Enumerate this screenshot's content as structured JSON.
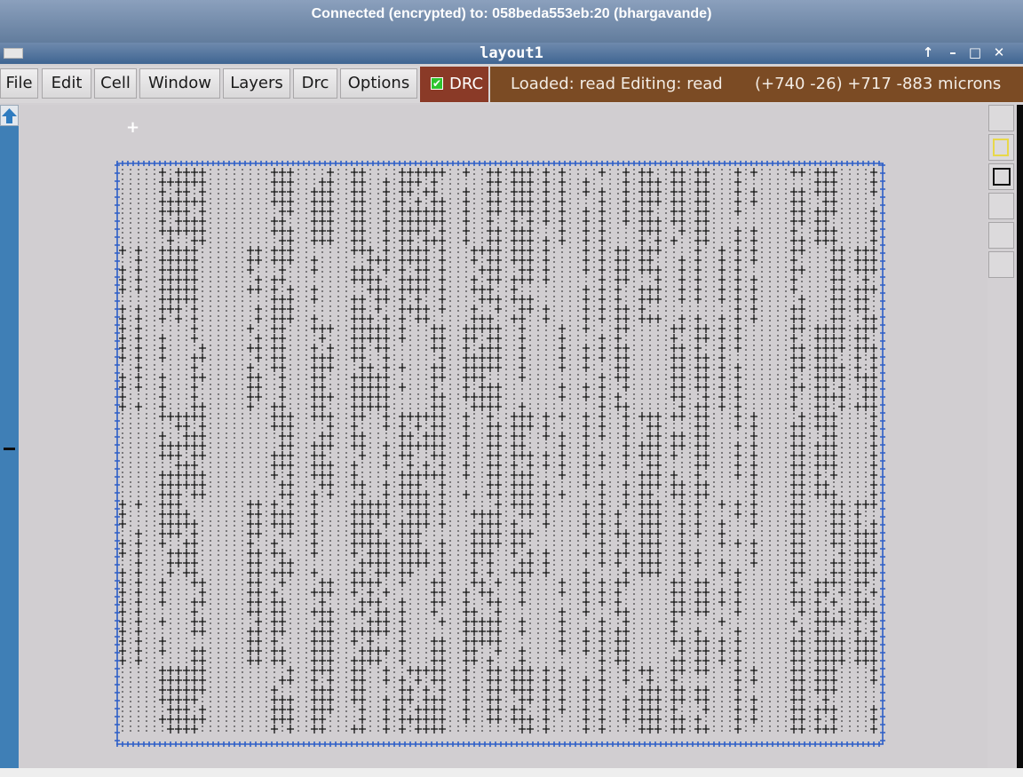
{
  "vnc": {
    "banner": "Connected (encrypted) to: 058beda553eb:20 (bhargavande)"
  },
  "window": {
    "title": "layout1"
  },
  "menu": {
    "file": "File",
    "edit": "Edit",
    "cell": "Cell",
    "window": "Window",
    "layers": "Layers",
    "drc": "Drc",
    "options": "Options"
  },
  "drc_toggle": {
    "label": "DRC",
    "checked": true
  },
  "status": {
    "message": "Loaded: read Editing: read",
    "coordinates": "(+740 -26) +717 -883 microns"
  },
  "colors": {
    "status_bg": "#7b4b24",
    "drc_bg": "#8a3a27",
    "scrollbar": "#3f7fb6",
    "cell_boundary": "#2e5fc7",
    "cell_glyph": "#111111"
  },
  "icons": {
    "scroll_up": "arrow-up-icon",
    "palette": [
      "tool-icon",
      "box-yellow-icon",
      "box-black-icon",
      "tool-icon",
      "tool-icon",
      "tool-icon"
    ]
  }
}
